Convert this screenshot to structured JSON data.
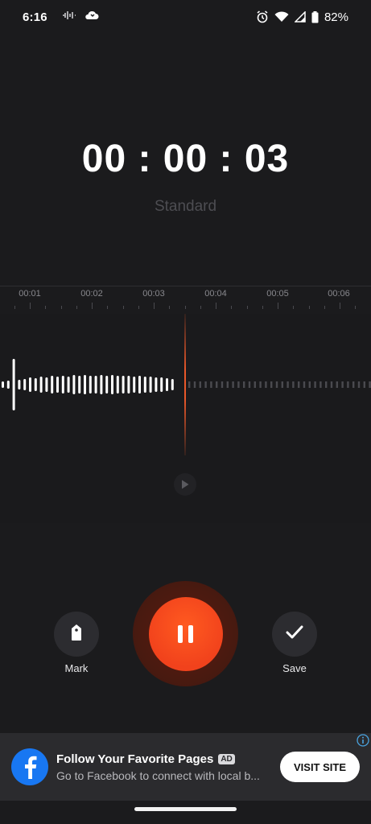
{
  "status_bar": {
    "time": "6:16",
    "battery": "82%",
    "icons": [
      "audio-wave-icon",
      "cloud-icon",
      "alarm-icon",
      "wifi-icon",
      "signal-icon",
      "battery-icon"
    ]
  },
  "recorder": {
    "timer": "00 : 00 : 03",
    "mode": "Standard",
    "timeline_labels": [
      "00:01",
      "00:02",
      "00:03",
      "00:04",
      "00:05",
      "00:06"
    ],
    "accent_color": "#e8572a"
  },
  "controls": {
    "mark_label": "Mark",
    "save_label": "Save",
    "record_state": "recording"
  },
  "ad": {
    "title": "Follow Your Favorite Pages",
    "badge": "AD",
    "subtitle": "Go to Facebook to connect with local b...",
    "cta": "VISIT SITE",
    "brand_color": "#1877f2"
  }
}
